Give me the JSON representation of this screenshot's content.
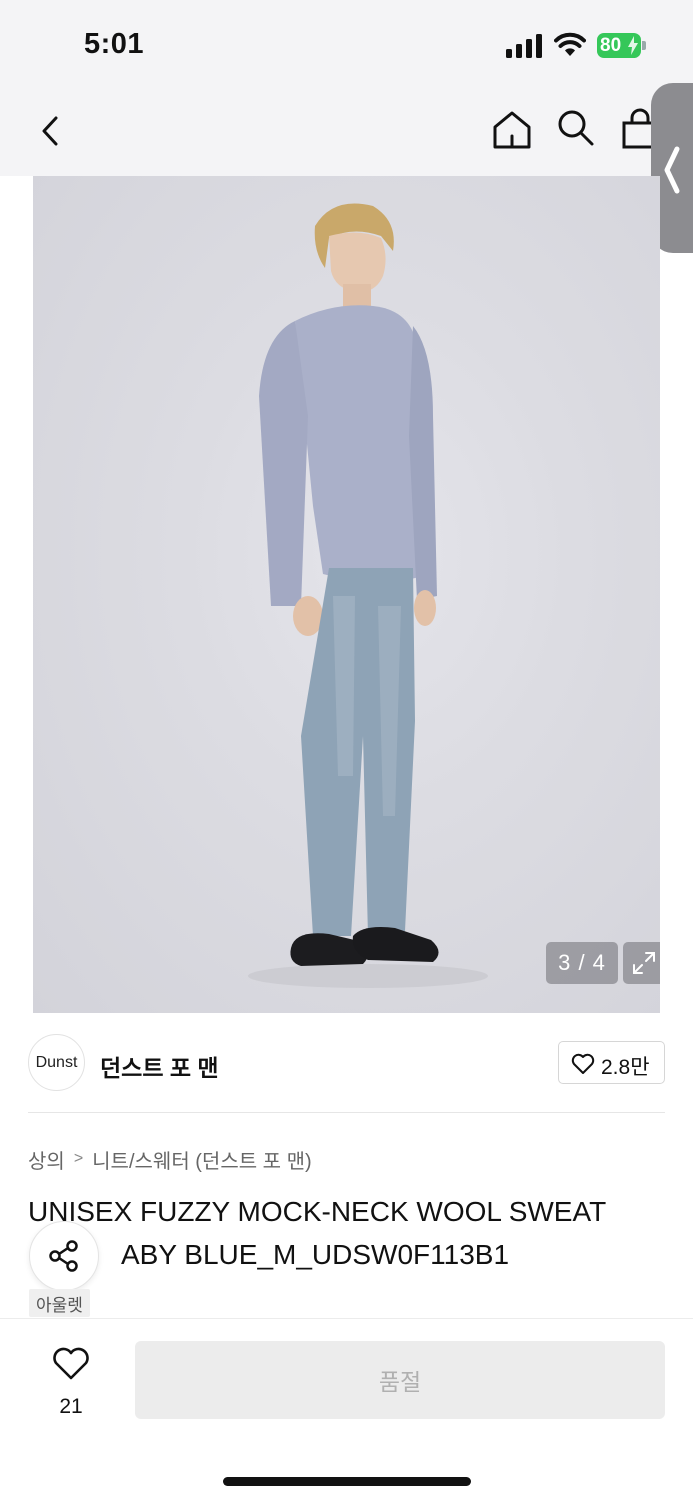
{
  "status_bar": {
    "time": "5:01",
    "battery_level": "80",
    "battery_color": "#35c759"
  },
  "nav": {
    "icons": [
      "back-icon",
      "home-icon",
      "search-icon",
      "shopping-bag-icon"
    ]
  },
  "product_image": {
    "page_indicator": "3 / 4",
    "current_page": 3,
    "total_pages": 4
  },
  "brand": {
    "logo_text": "Dunst",
    "name": "던스트 포 맨",
    "like_count": "2.8만"
  },
  "breadcrumb": {
    "items": [
      "상의",
      "니트/스웨터 (던스트 포 맨)"
    ]
  },
  "product": {
    "title_line1": "UNISEX FUZZY MOCK-NECK WOOL SWEAT",
    "title_line2": "ABY BLUE_M_UDSW0F113B1",
    "tag": "아울렛"
  },
  "bottom_bar": {
    "wish_count": "21",
    "soldout_label": "품절"
  }
}
